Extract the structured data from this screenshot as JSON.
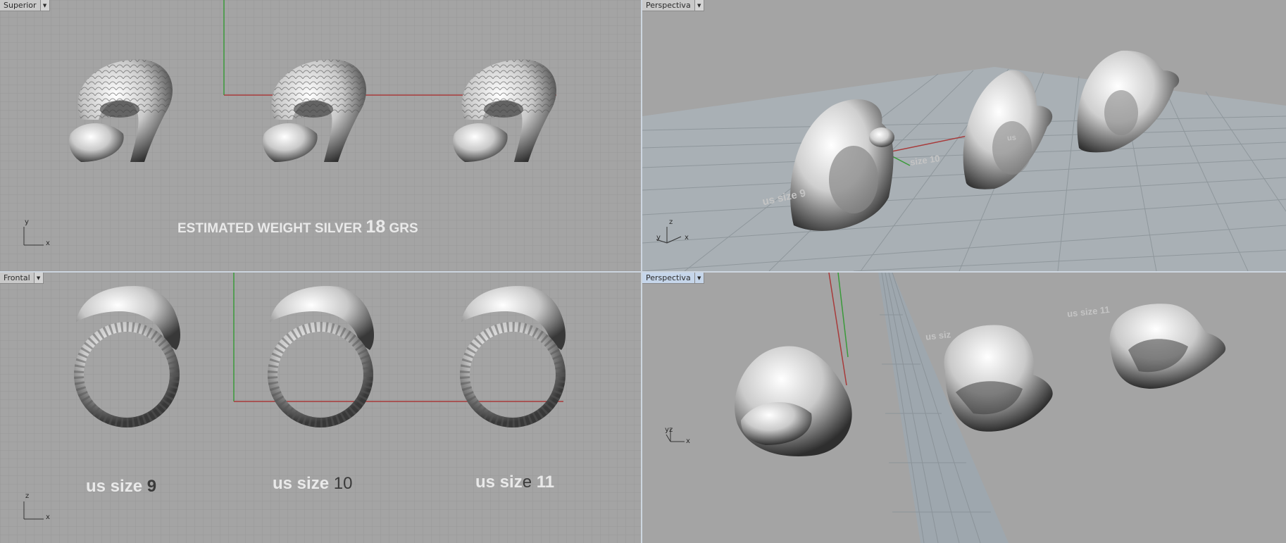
{
  "viewports": {
    "top": {
      "label": "Superior",
      "estimated_weight": {
        "prefix": "ESTIMATED WEIGHT SILVER",
        "value": "18",
        "unit": "GRS"
      }
    },
    "perspective1": {
      "label": "Perspectiva",
      "size_tags": [
        "us size 9",
        "size 10",
        "us"
      ]
    },
    "front": {
      "label": "Frontal",
      "sizes": [
        {
          "prefix": "us size",
          "num": "9"
        },
        {
          "prefix": "us size",
          "num": "10"
        },
        {
          "prefix": "us siz",
          "mid": "e",
          "num": "11"
        }
      ]
    },
    "perspective2": {
      "label": "Perspectiva",
      "size_tags": [
        "us siz",
        "us size 11"
      ]
    }
  },
  "axes": {
    "x": "x",
    "y": "y",
    "z": "z"
  },
  "colors": {
    "grid_line": "#9a9a9a",
    "x_axis": "#a83a3a",
    "y_axis": "#3a9a3a",
    "active_label": "#c6d6ea"
  },
  "icons": {
    "dropdown": "chevron-down-icon"
  }
}
